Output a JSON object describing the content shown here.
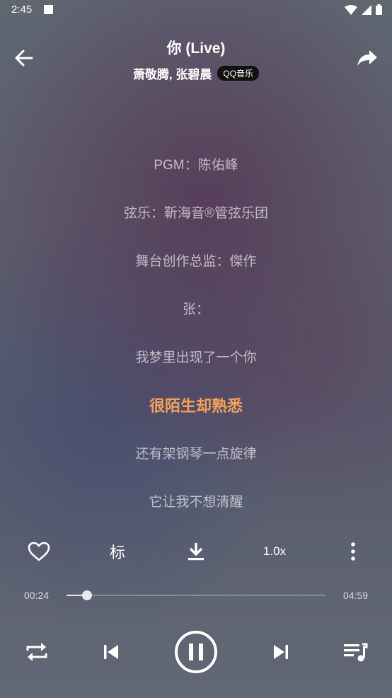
{
  "status_bar": {
    "time": "2:45"
  },
  "header": {
    "title": "你 (Live)",
    "artists": "萧敬腾, 张碧晨",
    "source_badge": "QQ音乐"
  },
  "lyrics": {
    "lines": [
      "PGM：陈佑峰",
      "弦乐：靳海音®管弦乐团",
      "舞台创作总监：傑作",
      "张：",
      "我梦里出现了一个你",
      "很陌生却熟悉",
      "还有架钢琴一点旋律",
      "它让我不想清醒"
    ],
    "active_index": 5
  },
  "controls": {
    "mark_label": "标",
    "speed_label": "1.0x"
  },
  "progress": {
    "current": "00:24",
    "total": "04:59",
    "fraction": 0.08
  },
  "colors": {
    "active_lyric": "#f4a25a",
    "inactive_lyric": "rgba(255,255,255,0.62)"
  }
}
